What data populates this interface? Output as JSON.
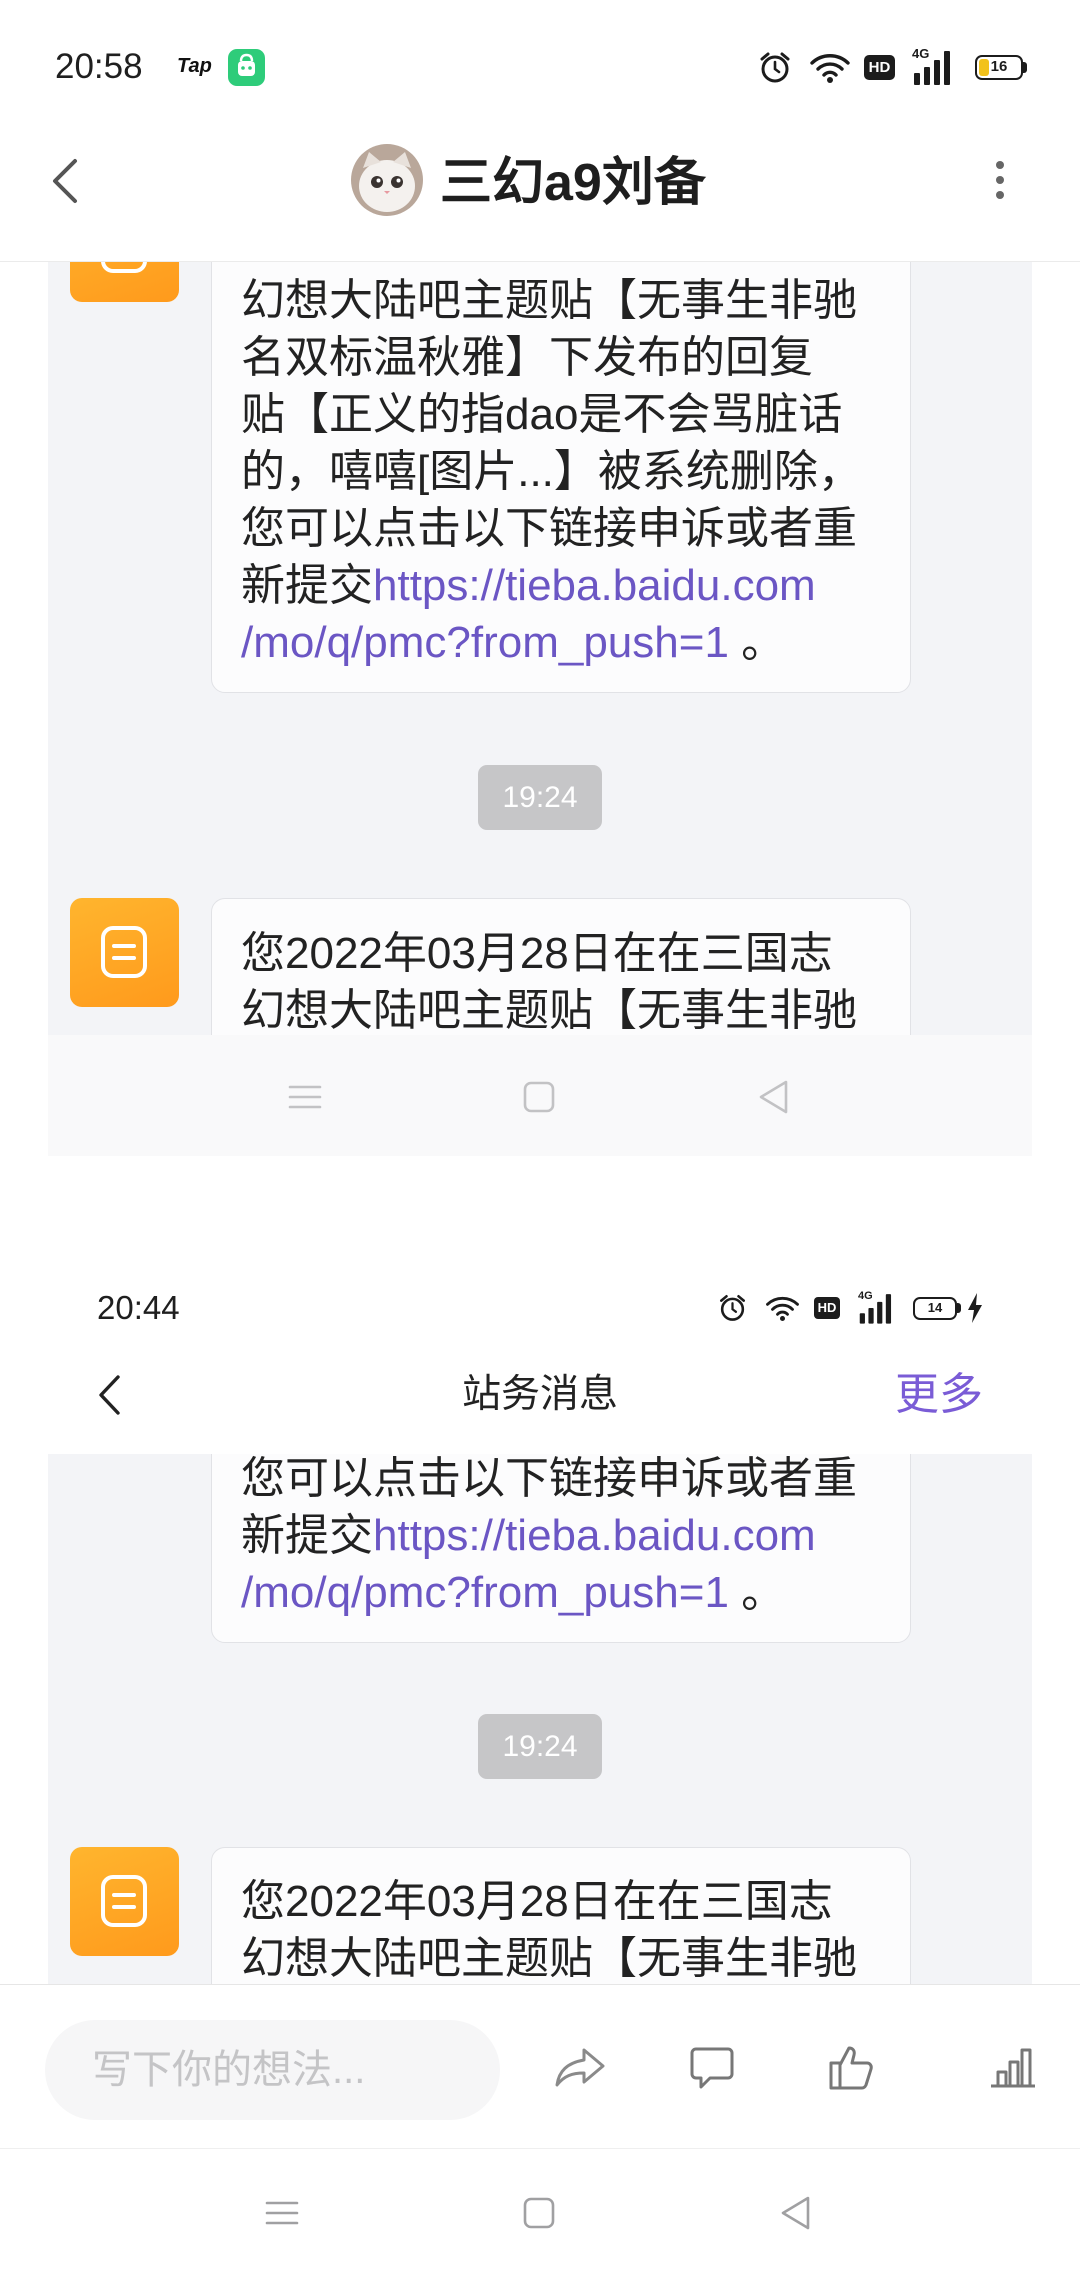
{
  "status_bar": {
    "time": "20:58",
    "app_badge": "Tap",
    "hd_badge": "HD",
    "network": "4G",
    "battery_level": "16",
    "icons": [
      "green-app-icon",
      "alarm-icon",
      "wifi-icon",
      "hd-icon",
      "signal-4g-icon",
      "battery-icon"
    ]
  },
  "header": {
    "title": "三幻a9刘备",
    "avatar": "cat-avatar",
    "back_icon": "chevron-left-icon",
    "more_icon": "more-vertical-icon"
  },
  "post_image": {
    "screenshot_1": {
      "message_1": {
        "lines": [
          "幻想大陆吧主题贴【无事生非驰",
          "名双标温秋雅】下发布的回复",
          "贴【正义的指dao是不会骂脏话",
          "的，嘻嘻[图片...】被系统删除，",
          "您可以点击以下链接申诉或者重"
        ],
        "link_line_1": {
          "prefix": "新提交",
          "link": "https://tieba.baidu.com"
        },
        "link_line_2": {
          "link": "/mo/q/pmc?from_push=1",
          "suffix": " 。"
        }
      },
      "timestamp": "19:24",
      "message_2": {
        "lines": [
          "您2022年03月28日在在三国志",
          "幻想大陆吧主题贴【无事生非驰"
        ]
      },
      "nav_icons": [
        "menu-icon",
        "home-icon",
        "back-triangle-icon"
      ]
    },
    "screenshot_2": {
      "status_bar": {
        "time": "20:44",
        "hd_badge": "HD",
        "network": "4G",
        "battery_level": "14"
      },
      "header": {
        "title": "站务消息",
        "more_label": "更多"
      },
      "message_1": {
        "lines": [
          "您可以点击以下链接申诉或者重"
        ],
        "link_line_1": {
          "prefix": "新提交",
          "link": "https://tieba.baidu.com"
        },
        "link_line_2": {
          "link": "/mo/q/pmc?from_push=1",
          "suffix": " 。"
        }
      },
      "timestamp": "19:24",
      "message_2": {
        "lines": [
          "您2022年03月28日在在三国志",
          "幻想大陆吧主题贴【无事生非驰"
        ]
      }
    }
  },
  "bottom_bar": {
    "input_placeholder": "写下你的想法...",
    "actions": [
      {
        "icon": "share-icon"
      },
      {
        "icon": "comment-icon"
      },
      {
        "icon": "like-icon"
      },
      {
        "icon": "stats-icon"
      }
    ]
  },
  "system_nav": {
    "icons": [
      "menu-icon",
      "home-icon",
      "back-triangle-icon"
    ]
  },
  "colors": {
    "link": "#6b56c4",
    "more_accent": "#7a5cd6",
    "notice_icon_top": "#ffb52e",
    "notice_icon_bottom": "#ff9a1c",
    "timestamp_bg": "#c6c6c8",
    "content_bg": "#f3f4f7"
  }
}
